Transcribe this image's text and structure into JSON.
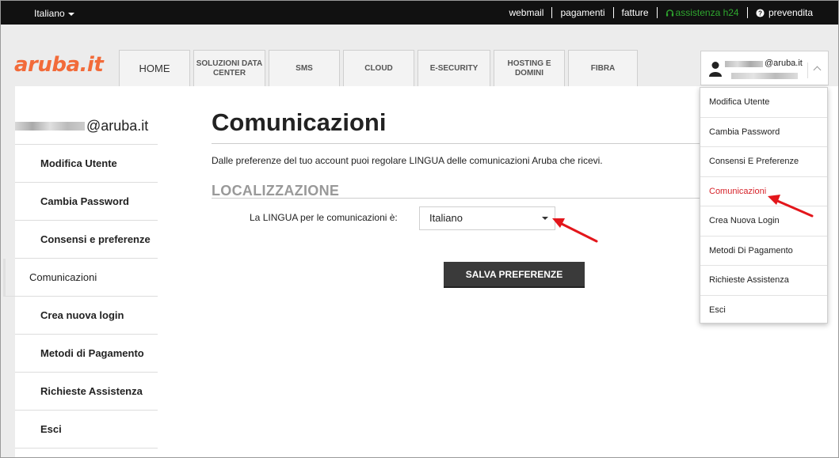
{
  "topbar": {
    "language": "Italiano",
    "links": [
      "webmail",
      "pagamenti",
      "fatture",
      "assistenza h24",
      "prevendita"
    ]
  },
  "header": {
    "logo": "aruba.it",
    "tabs": [
      "HOME",
      "SOLUZIONI DATA CENTER",
      "SMS",
      "CLOUD",
      "E-SECURITY",
      "HOSTING E DOMINI",
      "FIBRA"
    ]
  },
  "user": {
    "email_suffix": "@aruba.it"
  },
  "dropdown": {
    "items": [
      "Modifica Utente",
      "Cambia Password",
      "Consensi E Preferenze",
      "Comunicazioni",
      "Crea Nuova Login",
      "Metodi Di Pagamento",
      "Richieste Assistenza",
      "Esci"
    ],
    "active_color": "#d6232a"
  },
  "sidebar": {
    "email_suffix": "@aruba.it",
    "items": [
      "Modifica Utente",
      "Cambia Password",
      "Consensi e preferenze",
      "Comunicazioni",
      "Crea nuova login",
      "Metodi di Pagamento",
      "Richieste Assistenza",
      "Esci"
    ]
  },
  "main": {
    "title": "Comunicazioni",
    "description": "Dalle preferenze del tuo account puoi regolare LINGUA delle comunicazioni Aruba che ricevi.",
    "section": "LOCALIZZAZIONE",
    "field_label_pre": "La ",
    "field_label_bold": "LINGUA",
    "field_label_post": " per le comunicazioni è:",
    "language_value": "Italiano",
    "save_button": "SALVA PREFERENZE"
  },
  "colors": {
    "logo": "#f26b3a",
    "assistance": "#2fa72f",
    "arrow": "#e3161b"
  }
}
